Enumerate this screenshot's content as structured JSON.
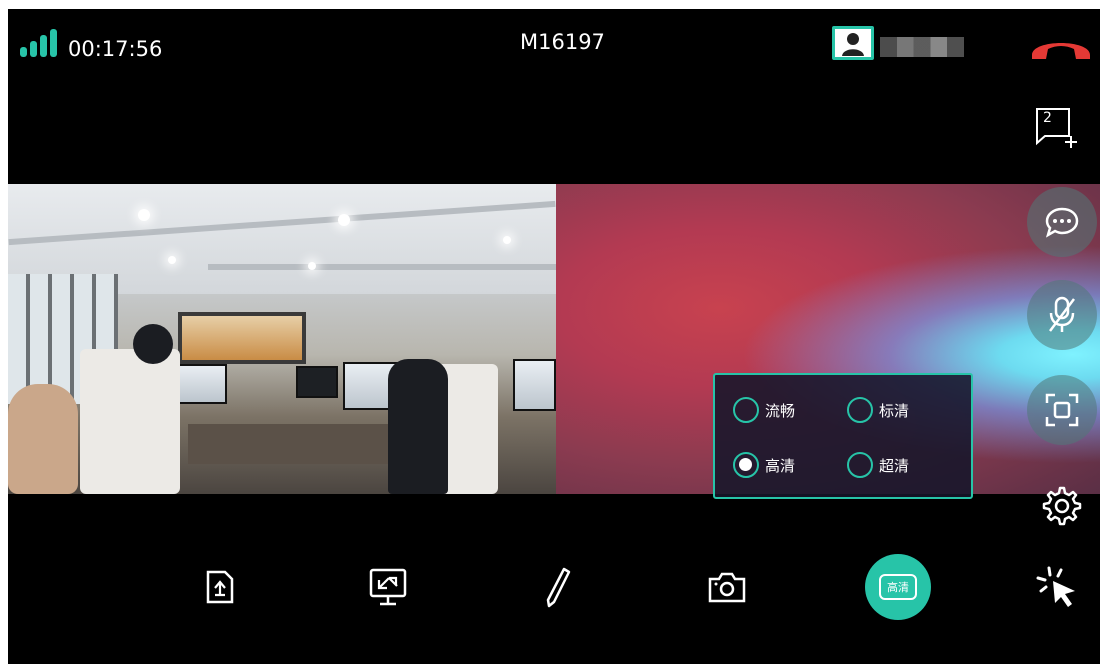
{
  "status_bar": {
    "call_time": "00:17:56",
    "meeting_id": "M16197"
  },
  "side_toolbar": {
    "participant_count": "2",
    "icons": [
      "add-participant-icon",
      "chat-icon",
      "microphone-muted-icon",
      "screenshot-frame-icon",
      "gear-icon"
    ]
  },
  "quality_menu": {
    "options": [
      {
        "label": "流畅",
        "selected": false
      },
      {
        "label": "标清",
        "selected": false
      },
      {
        "label": "高清",
        "selected": true
      },
      {
        "label": "超清",
        "selected": false
      }
    ]
  },
  "bottom_toolbar": {
    "icons": [
      "upload-file-icon",
      "screen-share-icon",
      "pen-icon",
      "camera-icon",
      "hd-quality-icon",
      "laser-pointer-icon"
    ],
    "quality_button_label": "高清"
  },
  "colors": {
    "accent": "#27c4a8",
    "hangup": "#e53935",
    "background": "#000000"
  }
}
